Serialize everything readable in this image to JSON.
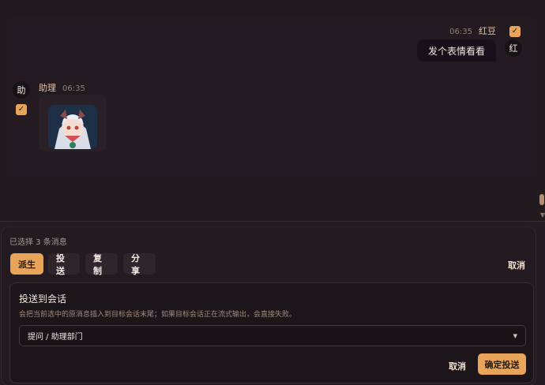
{
  "chat": {
    "outgoing": {
      "time": "06:35",
      "sender": "红豆",
      "avatar": "红",
      "text": "发个表情看看",
      "checked": "✓"
    },
    "incoming": {
      "avatar": "助",
      "sender": "助理",
      "time": "06:35",
      "checked": "✓",
      "sticker_icon": "sticker-icon"
    }
  },
  "selection": {
    "summary": "已选择 3 条消息",
    "tabs": [
      {
        "label": "派生",
        "active": true
      },
      {
        "label": "投送",
        "active": false
      },
      {
        "label": "复制",
        "active": false
      },
      {
        "label": "分享",
        "active": false
      }
    ],
    "cancel_label": "取消"
  },
  "send_panel": {
    "title": "投送到会话",
    "description": "会把当前选中的原消息插入到目标会话末尾；如果目标会话正在流式输出，会直接失败。",
    "target_value": "提问 / 助理部门",
    "cancel_label": "取消",
    "confirm_label": "确定投送"
  },
  "colors": {
    "accent": "#e8a55a",
    "background": "#1f181d",
    "text": "#e9dfd7"
  }
}
